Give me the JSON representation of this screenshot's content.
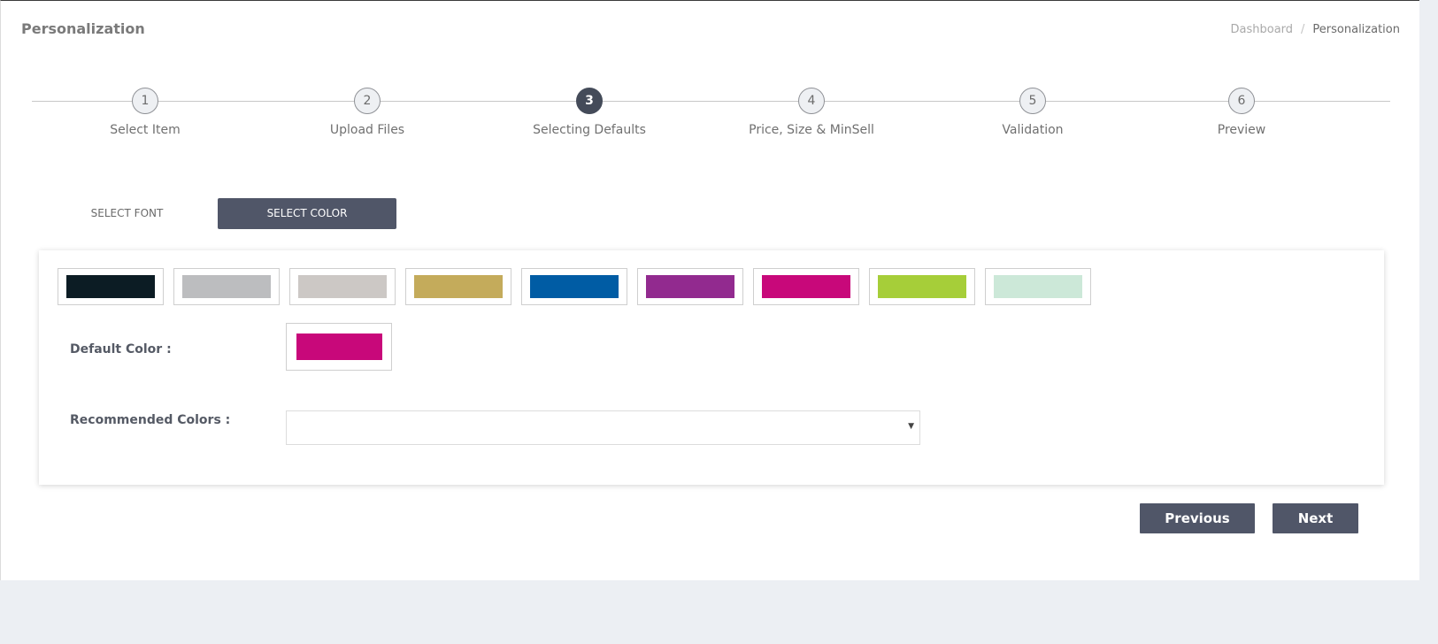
{
  "header": {
    "title": "Personalization",
    "breadcrumb": {
      "home": "Dashboard",
      "separator": "/",
      "current": "Personalization"
    }
  },
  "stepper": {
    "active_step": 3,
    "steps": [
      {
        "number": "1",
        "label": "Select Item"
      },
      {
        "number": "2",
        "label": "Upload Files"
      },
      {
        "number": "3",
        "label": "Selecting Defaults"
      },
      {
        "number": "4",
        "label": "Price, Size & MinSell"
      },
      {
        "number": "5",
        "label": "Validation"
      },
      {
        "number": "6",
        "label": "Preview"
      }
    ]
  },
  "tabs": {
    "font": "SELECT FONT",
    "color": "SELECT COLOR"
  },
  "palette": {
    "swatches": [
      "#0c1c24",
      "#bcbdbf",
      "#ccc8c5",
      "#c4ab5b",
      "#005ca4",
      "#922a8f",
      "#c8087a",
      "#a6ce39",
      "#cce8d8"
    ]
  },
  "defaults": {
    "default_label": "Default Color :",
    "default_color": "#c8087a",
    "recommended_label": "Recommended Colors :",
    "recommended_value": "",
    "caret": "▼"
  },
  "actions": {
    "previous": "Previous",
    "next": "Next"
  },
  "colors": {
    "accent": "#505668",
    "active_step": "#444b59",
    "page_bg": "#eceff3"
  }
}
